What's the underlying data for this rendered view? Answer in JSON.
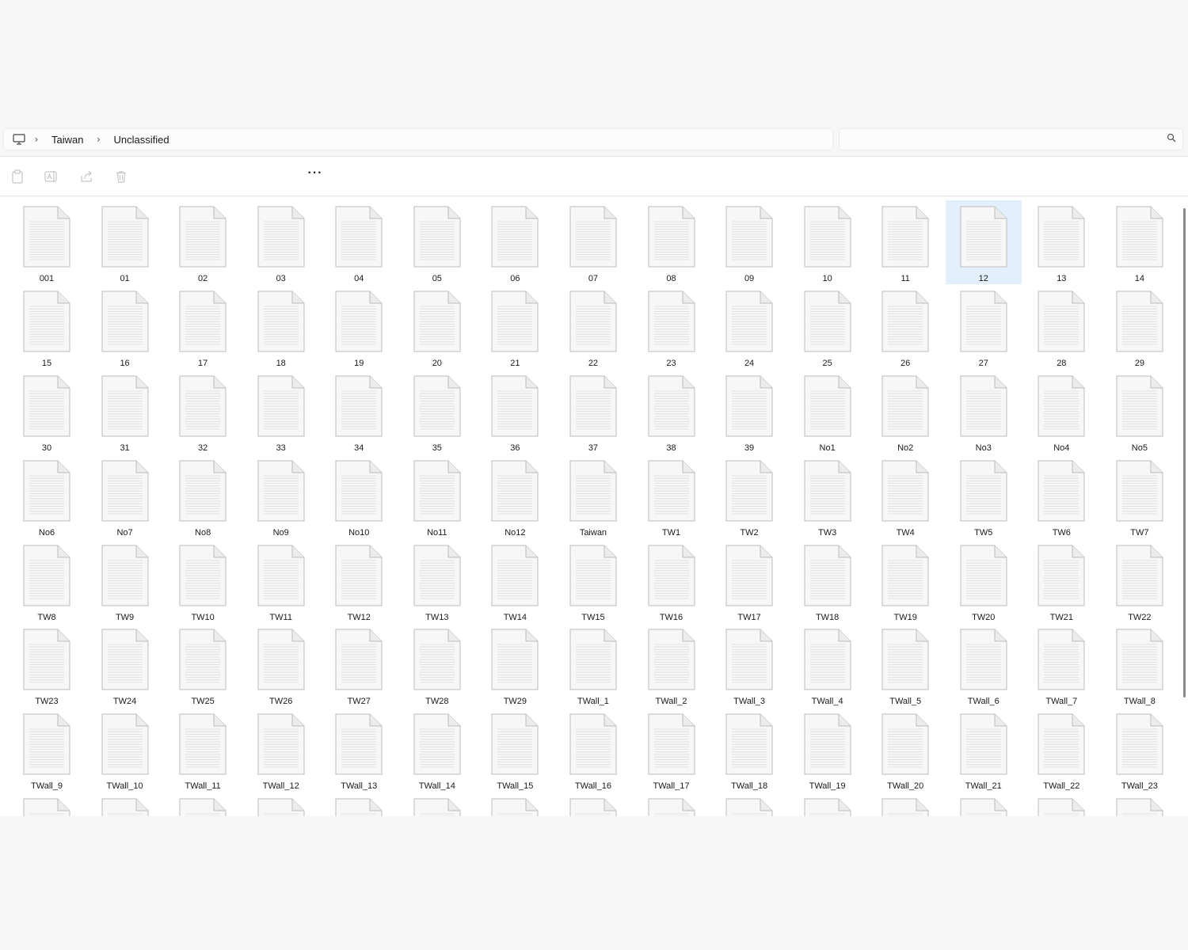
{
  "breadcrumb": {
    "segments": [
      "Taiwan",
      "Unclassified"
    ]
  },
  "search": {
    "placeholder": ""
  },
  "toolbar": {
    "icons": [
      "paste-icon",
      "rename-icon",
      "share-icon",
      "delete-icon"
    ],
    "more_label": "···"
  },
  "files": [
    "001",
    "01",
    "02",
    "03",
    "04",
    "05",
    "06",
    "07",
    "08",
    "09",
    "10",
    "11",
    "12",
    "13",
    "14",
    "15",
    "16",
    "17",
    "18",
    "19",
    "20",
    "21",
    "22",
    "23",
    "24",
    "25",
    "26",
    "27",
    "28",
    "29",
    "30",
    "31",
    "32",
    "33",
    "34",
    "35",
    "36",
    "37",
    "38",
    "39",
    "No1",
    "No2",
    "No3",
    "No4",
    "No5",
    "No6",
    "No7",
    "No8",
    "No9",
    "No10",
    "No11",
    "No12",
    "Taiwan",
    "TW1",
    "TW2",
    "TW3",
    "TW4",
    "TW5",
    "TW6",
    "TW7",
    "TW8",
    "TW9",
    "TW10",
    "TW11",
    "TW12",
    "TW13",
    "TW14",
    "TW15",
    "TW16",
    "TW17",
    "TW18",
    "TW19",
    "TW20",
    "TW21",
    "TW22",
    "TW23",
    "TW24",
    "TW25",
    "TW26",
    "TW27",
    "TW28",
    "TW29",
    "TWall_1",
    "TWall_2",
    "TWall_3",
    "TWall_4",
    "TWall_5",
    "TWall_6",
    "TWall_7",
    "TWall_8",
    "TWall_9",
    "TWall_10",
    "TWall_11",
    "TWall_12",
    "TWall_13",
    "TWall_14",
    "TWall_15",
    "TWall_16",
    "TWall_17",
    "TWall_18",
    "TWall_19",
    "TWall_20",
    "TWall_21",
    "TWall_22",
    "TWall_23"
  ],
  "selected_file": "12",
  "colors": {
    "selection": "#e3f0fc",
    "document_fill": "#f7f7f7",
    "document_border": "#bdbdbd"
  }
}
